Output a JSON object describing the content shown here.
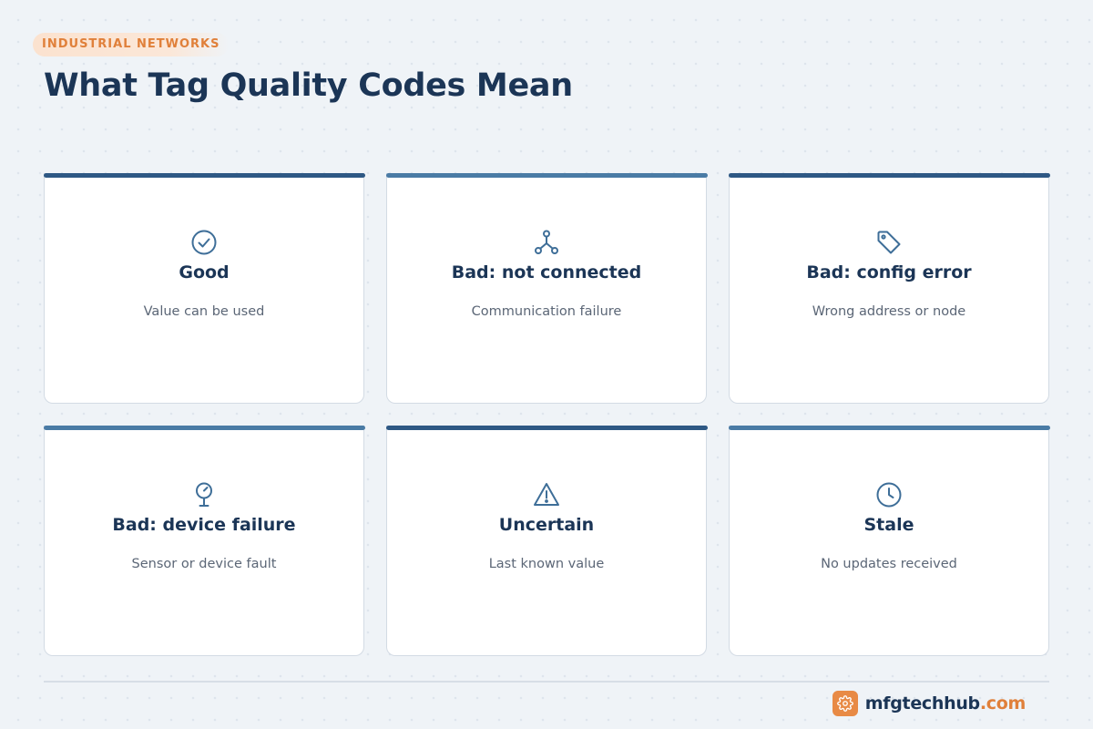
{
  "header": {
    "eyebrow": "INDUSTRIAL NETWORKS",
    "title": "What Tag Quality Codes Mean"
  },
  "cards": [
    {
      "title": "Good",
      "description": "Value can be used",
      "icon": "check-circle-icon"
    },
    {
      "title": "Bad: not connected",
      "description": "Communication failure",
      "icon": "network-icon"
    },
    {
      "title": "Bad: config error",
      "description": "Wrong address or node",
      "icon": "tag-icon"
    },
    {
      "title": "Bad: device failure",
      "description": "Sensor or device fault",
      "icon": "sensor-icon"
    },
    {
      "title": "Uncertain",
      "description": "Last known value",
      "icon": "warning-icon"
    },
    {
      "title": "Stale",
      "description": "No updates received",
      "icon": "clock-icon"
    }
  ],
  "footer": {
    "brand_name": "mfgtechhub",
    "brand_tld": ".com",
    "brand_icon": "gear-icon"
  },
  "colors": {
    "accent": "#e0803a",
    "primary": "#1b3556",
    "icon": "#3e6e98",
    "bar_dark": "#2e5884",
    "bar_light": "#4a7ba5",
    "background": "#eff3f7"
  }
}
